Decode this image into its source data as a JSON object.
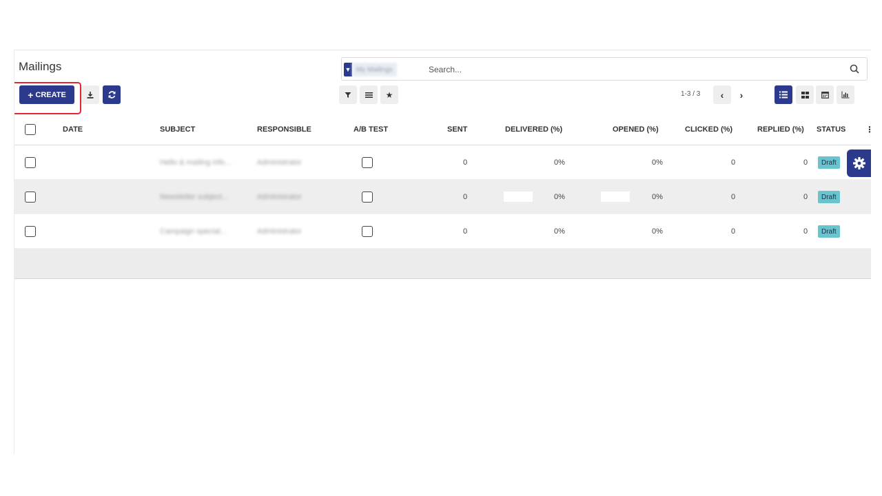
{
  "page": {
    "title": "Mailings"
  },
  "search": {
    "facet_label": "My Mailings",
    "placeholder": "Search..."
  },
  "toolbar": {
    "create_label": "CREATE",
    "create_plus": "+"
  },
  "pager": {
    "text": "1-3 / 3"
  },
  "table": {
    "columns": {
      "date": "DATE",
      "subject": "SUBJECT",
      "responsible": "RESPONSIBLE",
      "ab_test": "A/B TEST",
      "sent": "SENT",
      "delivered": "DELIVERED (%)",
      "opened": "OPENED (%)",
      "clicked": "CLICKED (%)",
      "replied": "REPLIED (%)",
      "status": "STATUS"
    },
    "rows": [
      {
        "subject": "Hello & mailing info...",
        "responsible": "Administrator",
        "sent": "0",
        "delivered": "0%",
        "opened": "0%",
        "clicked": "0",
        "replied": "0",
        "status": "Draft"
      },
      {
        "subject": "Newsletter subject...",
        "responsible": "Administrator",
        "sent": "0",
        "delivered": "0%",
        "opened": "0%",
        "clicked": "0",
        "replied": "0",
        "status": "Draft"
      },
      {
        "subject": "Campaign special...",
        "responsible": "Administrator",
        "sent": "0",
        "delivered": "0%",
        "opened": "0%",
        "clicked": "0",
        "replied": "0",
        "status": "Draft"
      }
    ]
  },
  "colors": {
    "primary": "#2b3a8c",
    "draft_badge": "#69c4cd",
    "highlight": "#e3262b"
  }
}
